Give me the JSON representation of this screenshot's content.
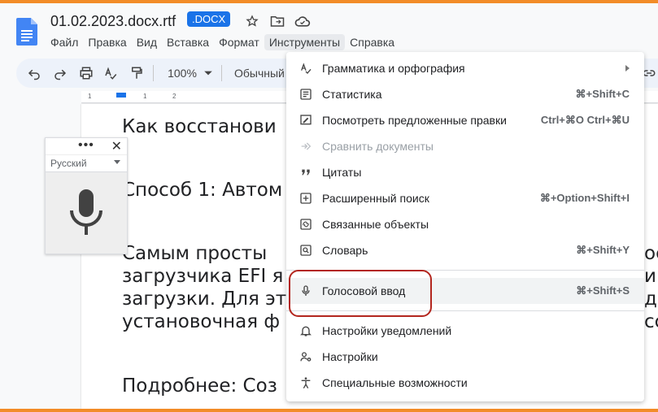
{
  "document": {
    "title": "01.02.2023.docx.rtf",
    "badge": ".DOCX"
  },
  "menubar": [
    "Файл",
    "Правка",
    "Вид",
    "Вставка",
    "Формат",
    "Инструменты",
    "Справка"
  ],
  "toolbar": {
    "zoom": "100%",
    "style": "Обычный"
  },
  "ruler": [
    "1",
    "1",
    "2"
  ],
  "doc_lines": [
    "Как восстанови",
    "Способ 1: Автом",
    "Самым просты",
    "загрузчика EFI я",
    "загрузки. Для эт",
    "установочная ф",
    "Подробнее: Соз"
  ],
  "doc_right_fragments": [
    "ос",
    "ин",
    "ди",
    "сс"
  ],
  "voice_panel": {
    "language": "Русский"
  },
  "menu": {
    "items": [
      {
        "label": "Грамматика и орфография",
        "shortcut": "",
        "icon": "spellcheck-icon"
      },
      {
        "label": "Статистика",
        "shortcut": "⌘+Shift+C",
        "icon": "word-count-icon"
      },
      {
        "label": "Посмотреть предложенные правки",
        "shortcut": "Ctrl+⌘O Ctrl+⌘U",
        "icon": "review-edits-icon"
      },
      {
        "label": "Сравнить документы",
        "shortcut": "",
        "icon": "compare-icon"
      },
      {
        "label": "Цитаты",
        "shortcut": "",
        "icon": "quote-icon"
      },
      {
        "label": "Расширенный поиск",
        "shortcut": "⌘+Option+Shift+I",
        "icon": "explore-icon"
      },
      {
        "label": "Связанные объекты",
        "shortcut": "",
        "icon": "linked-objects-icon"
      },
      {
        "label": "Словарь",
        "shortcut": "⌘+Shift+Y",
        "icon": "dictionary-icon"
      },
      {
        "label": "Голосовой ввод",
        "shortcut": "⌘+Shift+S",
        "icon": "mic-icon"
      },
      {
        "label": "Настройки уведомлений",
        "shortcut": "",
        "icon": "bell-icon"
      },
      {
        "label": "Настройки",
        "shortcut": "",
        "icon": "settings-icon"
      },
      {
        "label": "Специальные возможности",
        "shortcut": "",
        "icon": "accessibility-icon"
      }
    ]
  },
  "colors": {
    "accent": "#1a73e8",
    "highlight_outline": "#b3261e",
    "frame": "#f28c28"
  }
}
